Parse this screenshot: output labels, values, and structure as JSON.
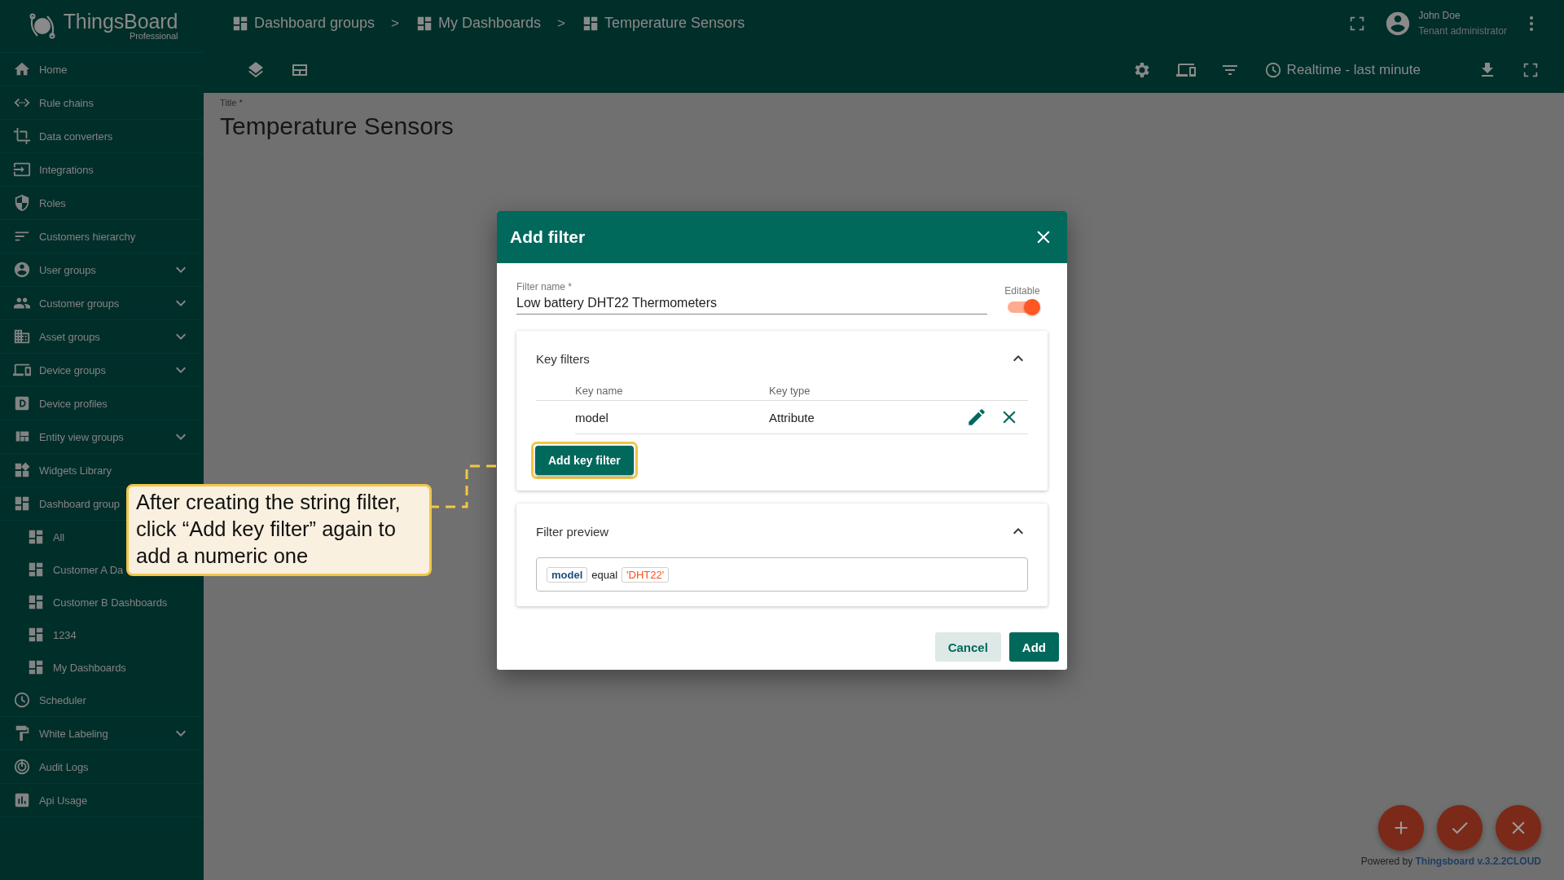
{
  "logo": {
    "name": "ThingsBoard",
    "edition": "Professional"
  },
  "sidebar": {
    "items": [
      {
        "label": "Home",
        "kind": "link"
      },
      {
        "label": "Rule chains",
        "kind": "link"
      },
      {
        "label": "Data converters",
        "kind": "link"
      },
      {
        "label": "Integrations",
        "kind": "link"
      },
      {
        "label": "Roles",
        "kind": "link"
      },
      {
        "label": "Customers hierarchy",
        "kind": "link"
      },
      {
        "label": "User groups",
        "kind": "group",
        "expanded": false
      },
      {
        "label": "Customer groups",
        "kind": "group",
        "expanded": false
      },
      {
        "label": "Asset groups",
        "kind": "group",
        "expanded": false
      },
      {
        "label": "Device groups",
        "kind": "group",
        "expanded": false
      },
      {
        "label": "Device profiles",
        "kind": "link"
      },
      {
        "label": "Entity view groups",
        "kind": "group",
        "expanded": false
      },
      {
        "label": "Widgets Library",
        "kind": "link"
      },
      {
        "label": "Dashboard group",
        "kind": "folder",
        "children": [
          {
            "label": "All"
          },
          {
            "label": "Customer A Da"
          },
          {
            "label": "Customer B Dashboards"
          },
          {
            "label": "1234"
          },
          {
            "label": "My Dashboards"
          }
        ]
      },
      {
        "label": "Scheduler",
        "kind": "link"
      },
      {
        "label": "White Labeling",
        "kind": "group",
        "expanded": false
      },
      {
        "label": "Audit Logs",
        "kind": "link"
      },
      {
        "label": "Api Usage",
        "kind": "link"
      }
    ]
  },
  "breadcrumbs": [
    {
      "label": "Dashboard groups"
    },
    {
      "label": "My Dashboards"
    },
    {
      "label": "Temperature Sensors"
    }
  ],
  "breadcrumb_separator": ">",
  "user": {
    "name": "John Doe",
    "role": "Tenant administrator"
  },
  "toolbar": {
    "timewindow": "Realtime - last minute"
  },
  "dashboard": {
    "title_label": "Title *",
    "title": "Temperature Sensors"
  },
  "dialog": {
    "title": "Add filter",
    "filter_name": {
      "label": "Filter name *",
      "value": "Low battery DHT22 Thermometers"
    },
    "editable": {
      "label": "Editable",
      "on": true
    },
    "key_filters": {
      "title": "Key filters",
      "expanded": true,
      "columns": [
        "Key name",
        "Key type"
      ],
      "rows": [
        {
          "key_name": "model",
          "key_type": "Attribute"
        }
      ],
      "add_button": "Add key filter"
    },
    "preview": {
      "title": "Filter preview",
      "expanded": true,
      "chips": [
        {
          "text": "model",
          "kind": "key"
        },
        {
          "text": "equal",
          "kind": "operation"
        },
        {
          "text": "'DHT22'",
          "kind": "value"
        }
      ]
    },
    "buttons": [
      {
        "label": "Cancel",
        "kind": "secondary"
      },
      {
        "label": "Add",
        "kind": "primary"
      }
    ]
  },
  "callout": {
    "text": "After creating the string filter, click “Add key filter” again to add a numeric one"
  },
  "footer": {
    "prefix": "Powered by",
    "link": "Thingsboard v.3.2.2CLOUD"
  }
}
